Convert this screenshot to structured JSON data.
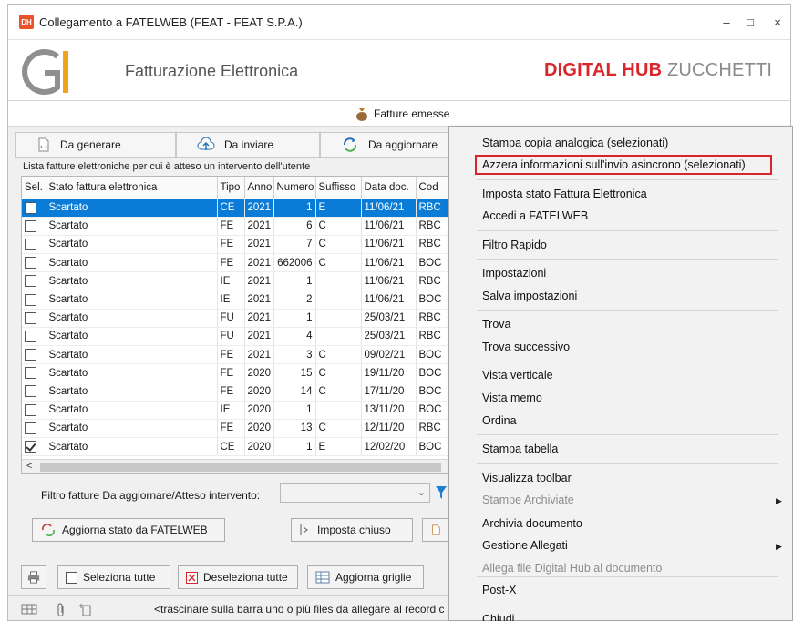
{
  "window": {
    "title": "Collegamento a FATELWEB (FEAT - FEAT S.P.A.)",
    "app_badge": "DH",
    "min": "–",
    "max": "□",
    "close": "×"
  },
  "header": {
    "logo": "G1",
    "module": "Fatturazione Elettronica",
    "brand_bold": "DIGITAL HUB",
    "brand_light": " ZUCCHETTI"
  },
  "section": {
    "label": "Fatture emesse"
  },
  "tabs": [
    {
      "label": "Da generare"
    },
    {
      "label": "Da inviare"
    },
    {
      "label": "Da aggiornare"
    }
  ],
  "list": {
    "caption": "Lista fatture elettroniche per cui è atteso un intervento dell'utente",
    "columns": [
      "Sel.",
      "Stato fattura elettronica",
      "Tipo",
      "Anno",
      "Numero",
      "Suffisso",
      "Data doc.",
      "Cod"
    ],
    "rows": [
      {
        "checked": false,
        "stato": "Scartato",
        "tipo": "CE",
        "anno": "2021",
        "numero": "1",
        "suffisso": "E",
        "data": "11/06/21",
        "cod": "RBC"
      },
      {
        "checked": false,
        "stato": "Scartato",
        "tipo": "FE",
        "anno": "2021",
        "numero": "6",
        "suffisso": "C",
        "data": "11/06/21",
        "cod": "RBC"
      },
      {
        "checked": false,
        "stato": "Scartato",
        "tipo": "FE",
        "anno": "2021",
        "numero": "7",
        "suffisso": "C",
        "data": "11/06/21",
        "cod": "RBC"
      },
      {
        "checked": false,
        "stato": "Scartato",
        "tipo": "FE",
        "anno": "2021",
        "numero": "662006",
        "suffisso": "C",
        "data": "11/06/21",
        "cod": "BOC"
      },
      {
        "checked": false,
        "stato": "Scartato",
        "tipo": "IE",
        "anno": "2021",
        "numero": "1",
        "suffisso": "",
        "data": "11/06/21",
        "cod": "RBC"
      },
      {
        "checked": false,
        "stato": "Scartato",
        "tipo": "IE",
        "anno": "2021",
        "numero": "2",
        "suffisso": "",
        "data": "11/06/21",
        "cod": "BOC"
      },
      {
        "checked": false,
        "stato": "Scartato",
        "tipo": "FU",
        "anno": "2021",
        "numero": "1",
        "suffisso": "",
        "data": "25/03/21",
        "cod": "RBC"
      },
      {
        "checked": false,
        "stato": "Scartato",
        "tipo": "FU",
        "anno": "2021",
        "numero": "4",
        "suffisso": "",
        "data": "25/03/21",
        "cod": "RBC"
      },
      {
        "checked": false,
        "stato": "Scartato",
        "tipo": "FE",
        "anno": "2021",
        "numero": "3",
        "suffisso": "C",
        "data": "09/02/21",
        "cod": "BOC"
      },
      {
        "checked": false,
        "stato": "Scartato",
        "tipo": "FE",
        "anno": "2020",
        "numero": "15",
        "suffisso": "C",
        "data": "19/11/20",
        "cod": "BOC"
      },
      {
        "checked": false,
        "stato": "Scartato",
        "tipo": "FE",
        "anno": "2020",
        "numero": "14",
        "suffisso": "C",
        "data": "17/11/20",
        "cod": "BOC"
      },
      {
        "checked": false,
        "stato": "Scartato",
        "tipo": "IE",
        "anno": "2020",
        "numero": "1",
        "suffisso": "",
        "data": "13/11/20",
        "cod": "BOC"
      },
      {
        "checked": false,
        "stato": "Scartato",
        "tipo": "FE",
        "anno": "2020",
        "numero": "13",
        "suffisso": "C",
        "data": "12/11/20",
        "cod": "RBC"
      },
      {
        "checked": true,
        "stato": "Scartato",
        "tipo": "CE",
        "anno": "2020",
        "numero": "1",
        "suffisso": "E",
        "data": "12/02/20",
        "cod": "BOC"
      }
    ],
    "scroll_left": "<"
  },
  "filter": {
    "label": "Filtro fatture Da aggiornare/Atteso intervento:",
    "value": "",
    "caret": "⌄"
  },
  "buttons": {
    "update_status": "Aggiorna stato da FATELWEB",
    "set_closed": "Imposta chiuso",
    "select_all": "Seleziona tutte",
    "deselect_all": "Deseleziona tutte",
    "refresh_grids": "Aggiorna griglie"
  },
  "status_bar": {
    "text": "<trascinare sulla barra uno o più files da allegare al record c"
  },
  "context_menu": {
    "items": [
      {
        "label": "Stampa copia analogica (selezionati)",
        "disabled": false,
        "submenu": false
      },
      {
        "label": "Azzera informazioni sull'invio asincrono (selezionati)",
        "disabled": false,
        "submenu": false,
        "highlighted": true
      },
      {
        "label": "Imposta stato Fattura Elettronica",
        "disabled": false,
        "submenu": false
      },
      {
        "label": "Accedi a FATELWEB",
        "disabled": false,
        "submenu": false
      },
      {
        "label": "Filtro Rapido",
        "disabled": false,
        "submenu": false
      },
      {
        "label": "Impostazioni",
        "disabled": false,
        "submenu": false
      },
      {
        "label": "Salva impostazioni",
        "disabled": false,
        "submenu": false
      },
      {
        "label": "Trova",
        "disabled": false,
        "submenu": false
      },
      {
        "label": "Trova successivo",
        "disabled": false,
        "submenu": false
      },
      {
        "label": "Vista verticale",
        "disabled": false,
        "submenu": false
      },
      {
        "label": "Vista memo",
        "disabled": false,
        "submenu": false
      },
      {
        "label": "Ordina",
        "disabled": false,
        "submenu": false
      },
      {
        "label": "Stampa tabella",
        "disabled": false,
        "submenu": false
      },
      {
        "label": "Visualizza toolbar",
        "disabled": false,
        "submenu": false
      },
      {
        "label": "Stampe Archiviate",
        "disabled": true,
        "submenu": true
      },
      {
        "label": "Archivia documento",
        "disabled": false,
        "submenu": false
      },
      {
        "label": "Gestione Allegati",
        "disabled": false,
        "submenu": true
      },
      {
        "label": "Allega file Digital Hub al documento",
        "disabled": true,
        "submenu": false
      },
      {
        "label": "Post-X",
        "disabled": false,
        "submenu": false
      },
      {
        "label": "Chiudi",
        "disabled": false,
        "submenu": false
      }
    ],
    "submenu_arrow": "▶"
  },
  "colors": {
    "brand_red": "#d9262a",
    "selection_blue": "#0a7bd6",
    "highlight_border": "#d6262a"
  }
}
